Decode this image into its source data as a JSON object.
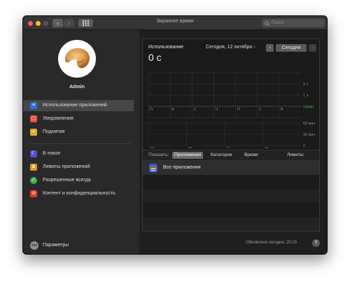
{
  "window": {
    "title": "Экранное время"
  },
  "toolbar": {
    "back": "‹",
    "forward": "›",
    "search_placeholder": "Поиск"
  },
  "user": {
    "name": "Admin"
  },
  "sidebar": {
    "items": [
      {
        "label": "Использование приложений",
        "icon": "stack-layers-icon",
        "color": "#2f6fd8",
        "active": true
      },
      {
        "label": "Уведомления",
        "icon": "notification-badge-icon",
        "color": "#e84b3a"
      },
      {
        "label": "Поднятия",
        "icon": "pickups-icon",
        "color": "#e8a92b"
      },
      {
        "label": "В покое",
        "icon": "downtime-moon-icon",
        "color": "#4a52cf"
      },
      {
        "label": "Лимиты приложений",
        "icon": "hourglass-icon",
        "color": "#e8912b"
      },
      {
        "label": "Разрешенные всегда",
        "icon": "checkmark-icon",
        "color": "#3fb24c"
      },
      {
        "label": "Контент и конфиденциальность",
        "icon": "no-entry-icon",
        "color": "#e03a30"
      }
    ],
    "settings_label": "Параметры"
  },
  "main": {
    "usage_label": "Использование",
    "usage_value": "0 с",
    "date": "Сегодня, 12 октября",
    "date_chevron": "◊",
    "prev": "‹",
    "today_button": "Сегодня",
    "next": "›"
  },
  "chart_data": {
    "type": "bar",
    "weekday_labels": [
      "П",
      "В",
      "С",
      "Ч",
      "П",
      "С",
      "В"
    ],
    "weekly_values": [
      0,
      0,
      0,
      0,
      0,
      0,
      0
    ],
    "weekly_y_labels": [
      "2 ч",
      "1 ч"
    ],
    "average_label": "средн.",
    "hourly_x_labels": [
      "00",
      "06",
      "12",
      "18"
    ],
    "hourly_y_labels": [
      "60 мин",
      "30 мин",
      "0"
    ],
    "hourly_values": [],
    "colors": {
      "grid": "#3a3a3a",
      "average": "#3cb043",
      "label": "#8a8a8a"
    }
  },
  "tabs": {
    "show_label": "Показать:",
    "items": [
      {
        "label": "Приложения",
        "selected": true
      },
      {
        "label": "Категории"
      },
      {
        "label": "Время"
      }
    ],
    "limits_label": "Лимиты"
  },
  "apps": [
    {
      "label": "Все приложения",
      "icon": "stack-layers-icon"
    }
  ],
  "footer": {
    "updated": "Обновлено сегодня, 20:19",
    "help": "?"
  }
}
